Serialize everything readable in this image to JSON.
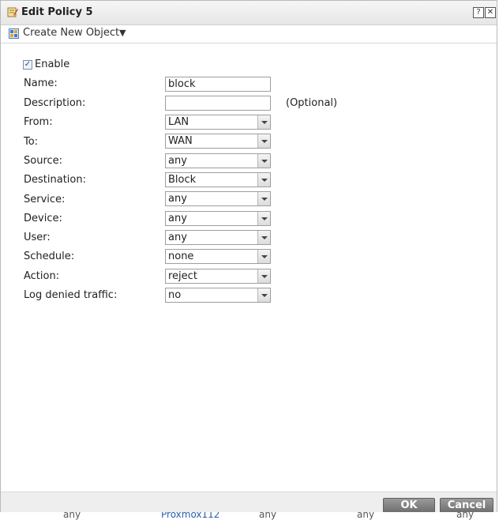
{
  "window": {
    "title": "Edit Policy 5",
    "help_label": "?",
    "close_label": "✕"
  },
  "toolbar": {
    "create_label": "Create New Object",
    "caret": "▼"
  },
  "form": {
    "enable": {
      "label": "Enable",
      "checked": true,
      "mark": "✓"
    },
    "name": {
      "label": "Name:",
      "value": "block"
    },
    "description": {
      "label": "Description:",
      "value": "",
      "hint": "(Optional)"
    },
    "from": {
      "label": "From:",
      "value": "LAN"
    },
    "to": {
      "label": "To:",
      "value": "WAN"
    },
    "source": {
      "label": "Source:",
      "value": "any"
    },
    "destination": {
      "label": "Destination:",
      "value": "Block"
    },
    "service": {
      "label": "Service:",
      "value": "any"
    },
    "device": {
      "label": "Device:",
      "value": "any"
    },
    "user": {
      "label": "User:",
      "value": "any"
    },
    "schedule": {
      "label": "Schedule:",
      "value": "none"
    },
    "action": {
      "label": "Action:",
      "value": "reject"
    },
    "log": {
      "label": "Log denied traffic:",
      "value": "no"
    }
  },
  "footer": {
    "ok_label": "OK",
    "cancel_label": "Cancel"
  },
  "background": {
    "cells": [
      "any",
      "Proxmox112",
      "any",
      "any",
      "any"
    ]
  },
  "colors": {
    "button_bg": "#7f7f7f",
    "link": "#2a5db0"
  }
}
